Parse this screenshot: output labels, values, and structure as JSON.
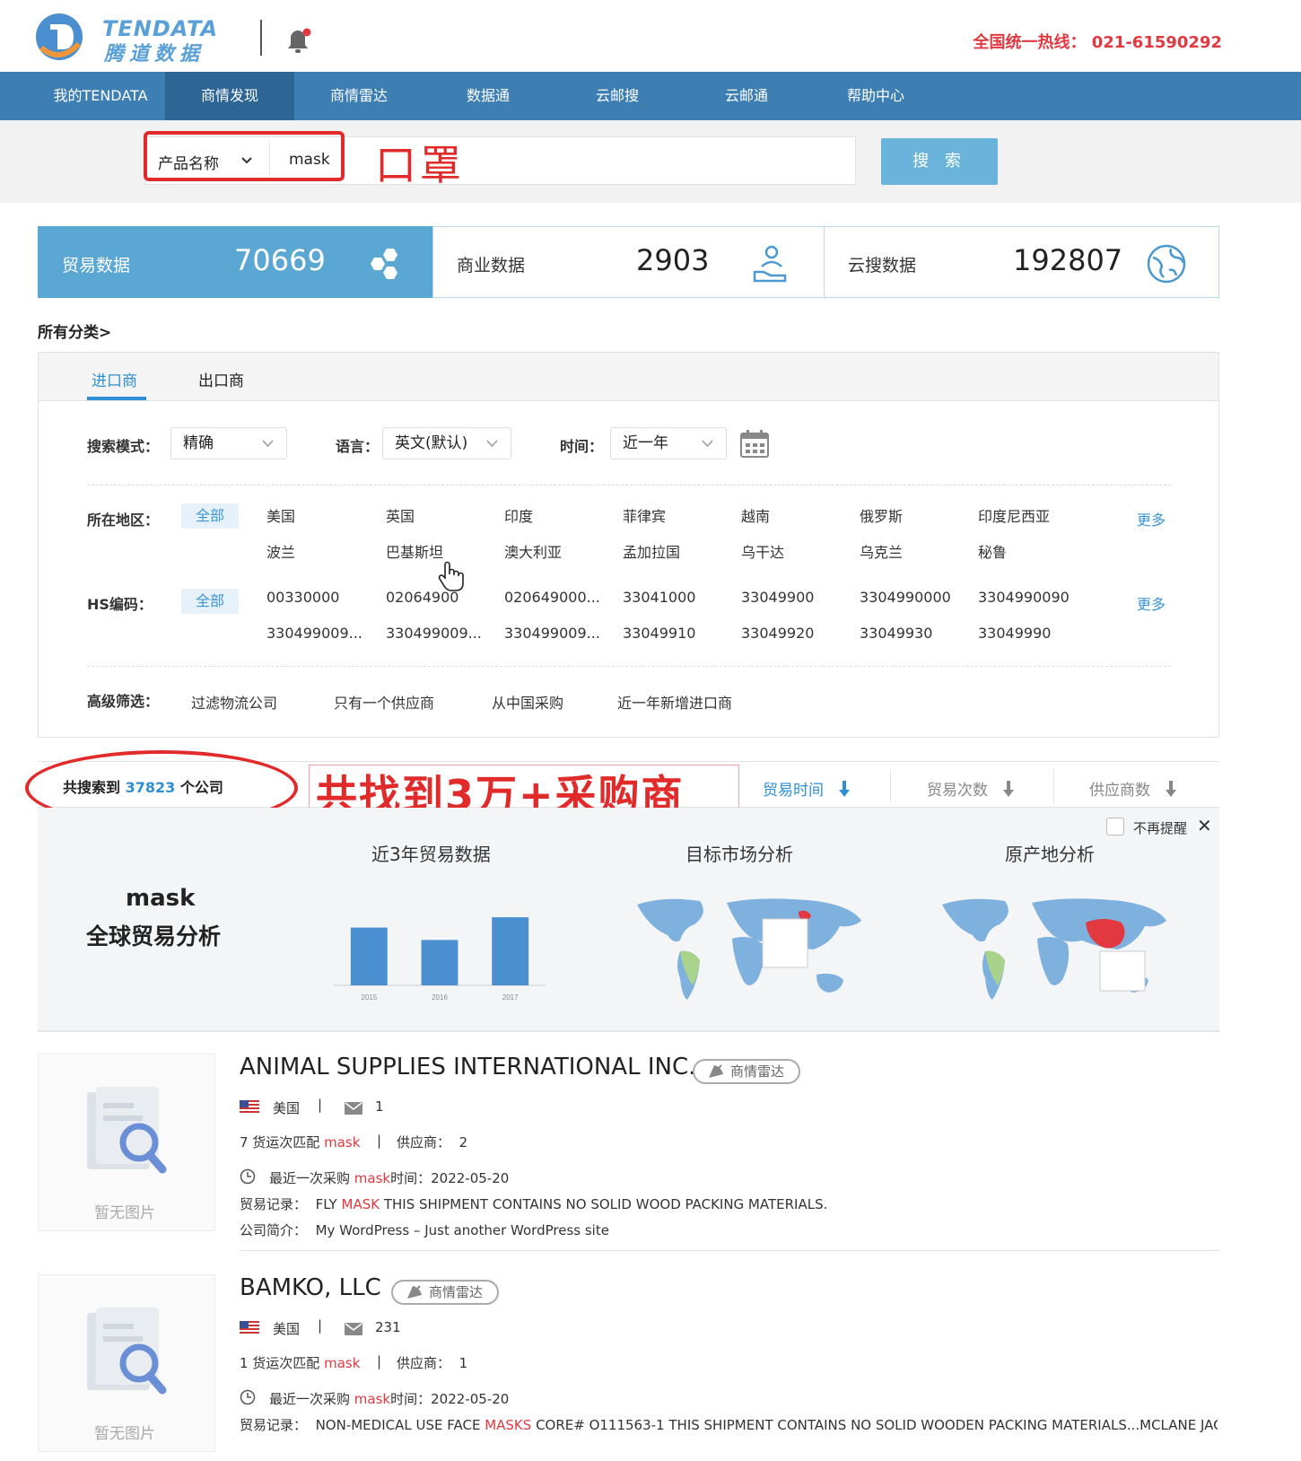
{
  "header": {
    "logo_en": "TENDATA",
    "logo_cn": "腾道数据",
    "hotline": "全国统一热线：  021-61590292"
  },
  "nav": {
    "items": [
      "我的TENDATA",
      "商情发现",
      "商情雷达",
      "数据通",
      "云邮搜",
      "云邮通",
      "帮助中心"
    ],
    "active_index": 1
  },
  "search": {
    "type_select": "产品名称",
    "value": "mask",
    "button_label": "搜 索"
  },
  "annotations": {
    "search_note": "口罩",
    "found_note": "共找到3万+采购商",
    "color": "#e12a2a"
  },
  "stats": [
    {
      "label": "贸易数据",
      "value": "70669",
      "icon": "hexagon-cluster-icon",
      "active": true
    },
    {
      "label": "商业数据",
      "value": "2903",
      "icon": "hand-people-icon",
      "active": false
    },
    {
      "label": "云搜数据",
      "value": "192807",
      "icon": "globe-icon",
      "active": false
    }
  ],
  "breadcrumb": "所有分类>",
  "tabs": [
    {
      "label": "进口商",
      "active": true
    },
    {
      "label": "出口商",
      "active": false
    }
  ],
  "filters": {
    "mode_label": "搜索模式：",
    "mode_value": "精确",
    "lang_label": "语言：",
    "lang_value": "英文(默认)",
    "time_label": "时间：",
    "time_value": "近一年",
    "region_label": "所在地区：",
    "all_label": "全部",
    "regions": [
      "美国",
      "英国",
      "印度",
      "菲律宾",
      "越南",
      "俄罗斯",
      "印度尼西亚",
      "波兰",
      "巴基斯坦",
      "澳大利亚",
      "孟加拉国",
      "乌干达",
      "乌克兰",
      "秘鲁"
    ],
    "hs_label": "HS编码：",
    "hs_codes": [
      "00330000",
      "02064900",
      "020649000...",
      "33041000",
      "33049900",
      "3304990000",
      "3304990090",
      "330499009...",
      "330499009...",
      "330499009...",
      "33049910",
      "33049920",
      "33049930",
      "33049990"
    ],
    "more_label": "更多",
    "advanced_label": "高级筛选：",
    "advanced": [
      "过滤物流公司",
      "只有一个供应商",
      "从中国采购",
      "近一年新增进口商"
    ]
  },
  "results": {
    "prefix": "共搜索到 ",
    "count": "37823",
    "suffix": " 个公司",
    "sort_options": [
      {
        "label": "贸易时间",
        "active": true
      },
      {
        "label": "贸易次数",
        "active": false
      },
      {
        "label": "供应商数",
        "active": false
      }
    ]
  },
  "analysis": {
    "no_remind": "不再提醒",
    "keyword": "mask",
    "subtitle": "全球贸易分析",
    "panels": [
      "近3年贸易数据",
      "目标市场分析",
      "原产地分析"
    ]
  },
  "chart_data": {
    "type": "bar",
    "categories": [
      "2015",
      "2016",
      "2017"
    ],
    "values": [
      140,
      110,
      165
    ],
    "ylim": [
      0,
      200
    ],
    "color": "#4a90d0"
  },
  "companies": [
    {
      "name": "ANIMAL SUPPLIES INTERNATIONAL INC.",
      "badge": "商情雷达",
      "country": "美国",
      "emails": "1",
      "shipments_prefix": "7 货运次匹配 ",
      "keyword": "mask",
      "supplier_label": "供应商：",
      "suppliers": "2",
      "last_purchase_prefix": "最近一次采购 ",
      "last_purchase_suffix": "时间：",
      "last_date": "2022-05-20",
      "trade_label": "贸易记录：",
      "trade_pre": "FLY ",
      "trade_hl": "MASK",
      "trade_post": " THIS SHIPMENT CONTAINS NO SOLID WOOD PACKING MATERIALS.",
      "intro_label": "公司简介：",
      "intro": "My WordPress – Just another WordPress site",
      "no_image": "暂无图片"
    },
    {
      "name": "BAMKO, LLC",
      "badge": "商情雷达",
      "country": "美国",
      "emails": "231",
      "shipments_prefix": "1 货运次匹配 ",
      "keyword": "mask",
      "supplier_label": "供应商：",
      "suppliers": "1",
      "last_purchase_prefix": "最近一次采购 ",
      "last_purchase_suffix": "时间：",
      "last_date": "2022-05-20",
      "trade_label": "贸易记录：",
      "trade_pre": "NON-MEDICAL USE FACE ",
      "trade_hl": "MASKS",
      "trade_post": " CORE# O111563-1 THIS SHIPMENT CONTAINS NO SOLID WOODEN PACKING MATERIALS...MCLANE JACK ...",
      "no_image": "暂无图片"
    }
  ]
}
